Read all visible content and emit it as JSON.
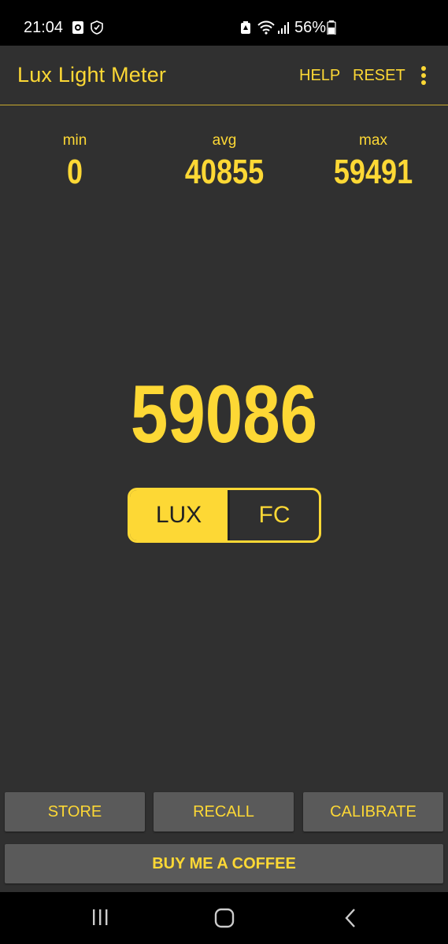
{
  "status_bar": {
    "time": "21:04",
    "battery_percent": "56%",
    "icons": [
      "notification-app-icon",
      "shield-icon",
      "battery-saver-icon",
      "wifi-icon",
      "signal-icon",
      "battery-icon"
    ]
  },
  "toolbar": {
    "title": "Lux Light Meter",
    "help_label": "HELP",
    "reset_label": "RESET",
    "overflow_icon": "more-vert-icon"
  },
  "stats": {
    "min": {
      "label": "min",
      "value": "0"
    },
    "avg": {
      "label": "avg",
      "value": "40855"
    },
    "max": {
      "label": "max",
      "value": "59491"
    }
  },
  "reading": {
    "value": "59086"
  },
  "unit_toggle": {
    "options": [
      "LUX",
      "FC"
    ],
    "selected": "LUX"
  },
  "buttons": {
    "store": "STORE",
    "recall": "RECALL",
    "calibrate": "CALIBRATE",
    "coffee": "BUY ME A COFFEE"
  },
  "colors": {
    "accent": "#fdd835",
    "background": "#303030",
    "button": "#5a5a5a"
  },
  "nav_bar": {
    "icons": [
      "recent-apps-icon",
      "home-icon",
      "back-icon"
    ]
  }
}
